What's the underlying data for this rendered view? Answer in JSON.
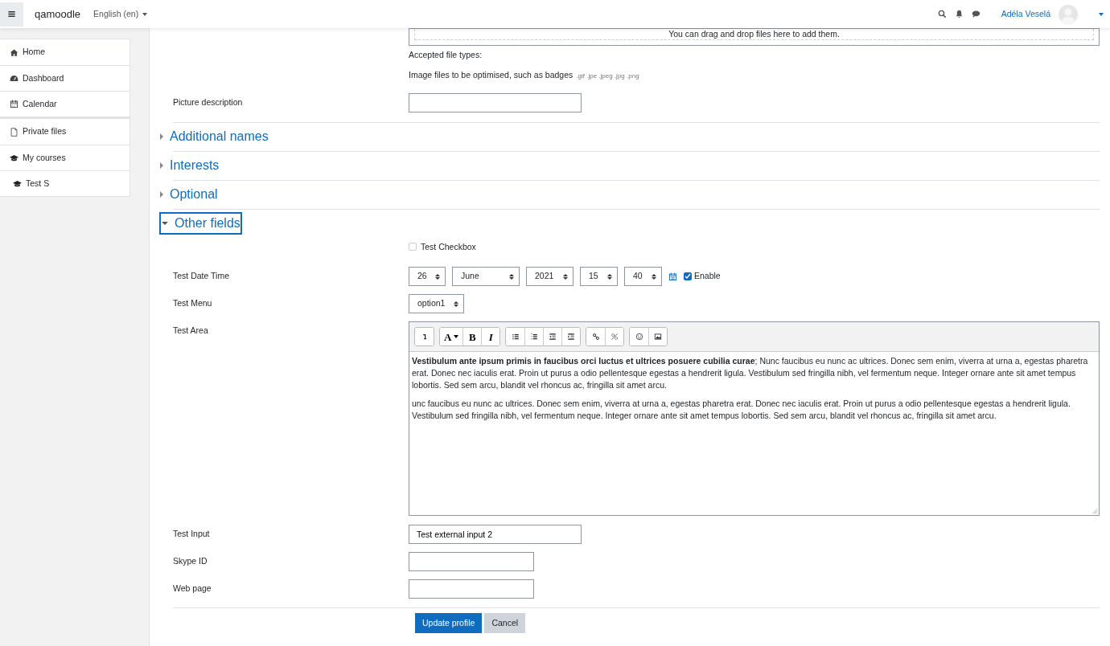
{
  "navbar": {
    "brand": "qamoodle",
    "language": "English (en)",
    "user_name": "Adéla Veselá"
  },
  "sidebar": {
    "groups": [
      {
        "items": [
          {
            "label": "Home"
          },
          {
            "label": "Dashboard"
          },
          {
            "label": "Calendar"
          }
        ]
      },
      {
        "items": [
          {
            "label": "Private files"
          },
          {
            "label": "My courses",
            "children": [
              {
                "label": "Test S"
              }
            ]
          }
        ]
      }
    ]
  },
  "file_picker": {
    "dropzone_text": "You can drag and drop files here to add them.",
    "accepted_label": "Accepted file types:",
    "accepted_description": "Image files to be optimised, such as badges",
    "accepted_extensions": ".gif .jpe .jpeg .jpg .png"
  },
  "picture_description": {
    "label": "Picture description"
  },
  "sections": [
    {
      "title": "Additional names",
      "expanded": false,
      "focused": false
    },
    {
      "title": "Interests",
      "expanded": false,
      "focused": false
    },
    {
      "title": "Optional",
      "expanded": false,
      "focused": false
    },
    {
      "title": "Other fields",
      "expanded": true,
      "focused": true
    }
  ],
  "other_fields": {
    "checkbox": {
      "label": "Test Checkbox",
      "checked": false
    },
    "date_time": {
      "label": "Test Date Time",
      "day": "26",
      "month": "June",
      "year": "2021",
      "hour": "15",
      "minute": "40",
      "enable_label": "Enable",
      "enabled": true
    },
    "menu": {
      "label": "Test Menu",
      "value": "option1"
    },
    "area": {
      "label": "Test Area",
      "toolbar": [
        {
          "buttons": [
            {
              "kind": "icon"
            }
          ]
        },
        {
          "buttons": [
            {
              "kind": "font",
              "label": "A",
              "caret": true
            },
            {
              "kind": "bold",
              "label": "B",
              "caret": false
            },
            {
              "kind": "italic",
              "label": "I",
              "caret": false
            }
          ]
        },
        {
          "buttons": [
            {
              "kind": "icon"
            },
            {
              "kind": "icon"
            },
            {
              "kind": "icon"
            },
            {
              "kind": "icon"
            }
          ]
        },
        {
          "buttons": [
            {
              "kind": "icon"
            },
            {
              "kind": "icon"
            }
          ]
        },
        {
          "buttons": [
            {
              "kind": "icon"
            },
            {
              "kind": "icon"
            }
          ]
        }
      ],
      "paragraphs": [
        "**Vestibulum ante ipsum primis in faucibus orci luctus et ultrices posuere cubilia curae**; Nunc faucibus eu nunc ac ultrices. Donec sem enim, viverra at urna a, egestas pharetra erat. Donec nec iaculis erat. Proin ut purus a odio pellentesque egestas a hendrerit ligula. Vestibulum sed fringilla nibh, vel fermentum neque. Integer ornare ante sit amet tempus lobortis. Sed sem arcu, blandit vel rhoncus ac, fringilla sit amet arcu.",
        "unc faucibus eu nunc ac ultrices. Donec sem enim, viverra at urna a, egestas pharetra erat. Donec nec iaculis erat. Proin ut purus a odio pellentesque egestas a hendrerit ligula. Vestibulum sed fringilla nibh, vel fermentum neque. Integer ornare ante sit amet tempus lobortis. Sed sem arcu, blandit vel rhoncus ac, fringilla sit amet arcu."
      ]
    },
    "test_input": {
      "label": "Test Input",
      "value": "Test external input 2"
    },
    "skype": {
      "label": "Skype ID"
    },
    "web_page": {
      "label": "Web page"
    }
  },
  "buttons": [
    {
      "label": "Update profile",
      "kind": "primary"
    },
    {
      "label": "Cancel",
      "kind": "secondary"
    }
  ]
}
